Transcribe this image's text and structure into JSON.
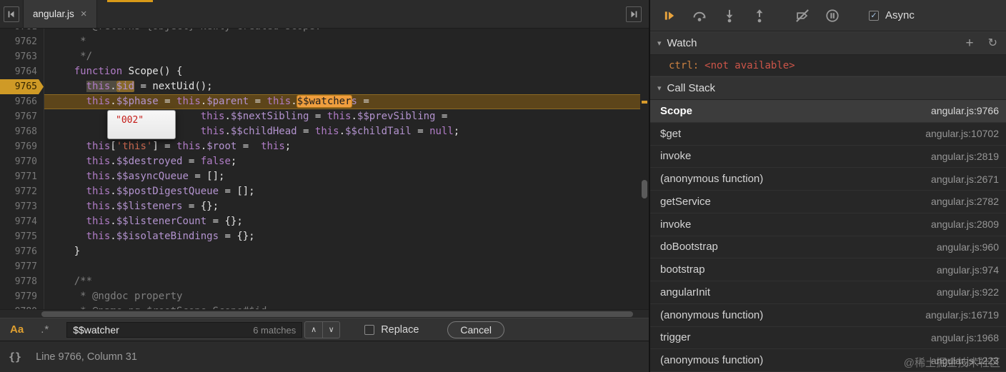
{
  "tab": {
    "title": "angular.js",
    "close": "×"
  },
  "icons": {
    "triangle_down": "▾",
    "plus": "+",
    "refresh": "↻",
    "chevron_up": "∧",
    "chevron_down": "∨",
    "check": "✓",
    "braces": "{}"
  },
  "editor": {
    "tooltip_value": "\"002\"",
    "lines": [
      {
        "n": 9761,
        "tokens": [
          {
            "t": "     * @returns {Object} Newly created scope.",
            "c": "c"
          }
        ]
      },
      {
        "n": 9762,
        "tokens": [
          {
            "t": "     *",
            "c": "c"
          }
        ]
      },
      {
        "n": 9763,
        "tokens": [
          {
            "t": "     */",
            "c": "c"
          }
        ]
      },
      {
        "n": 9764,
        "tokens": [
          {
            "t": "    ",
            "c": "d"
          },
          {
            "t": "function",
            "c": "k"
          },
          {
            "t": " Scope() {",
            "c": "d"
          }
        ]
      },
      {
        "n": 9765,
        "marker": true,
        "tokens": [
          {
            "t": "      ",
            "c": "d"
          },
          {
            "t": "this",
            "c": "k hovA"
          },
          {
            "t": ".",
            "c": "d hovA"
          },
          {
            "t": "$id",
            "c": "p hovB"
          },
          {
            "t": " = nextUid();",
            "c": "d"
          }
        ]
      },
      {
        "n": 9766,
        "exec": true,
        "tokens": [
          {
            "t": "      ",
            "c": "d"
          },
          {
            "t": "this",
            "c": "k"
          },
          {
            "t": ".",
            "c": "d"
          },
          {
            "t": "$$phase",
            "c": "p"
          },
          {
            "t": " = ",
            "c": "d"
          },
          {
            "t": "this",
            "c": "k"
          },
          {
            "t": ".",
            "c": "d"
          },
          {
            "t": "$parent",
            "c": "p"
          },
          {
            "t": " = ",
            "c": "d"
          },
          {
            "t": "this",
            "c": "k"
          },
          {
            "t": ".",
            "c": "d"
          },
          {
            "t": "$$watcher",
            "c": "p m"
          },
          {
            "t": "s",
            "c": "p"
          },
          {
            "t": " =",
            "c": "d"
          }
        ]
      },
      {
        "n": 9767,
        "tokens": [
          {
            "t": "                         ",
            "c": "d"
          },
          {
            "t": "this",
            "c": "k"
          },
          {
            "t": ".",
            "c": "d"
          },
          {
            "t": "$$nextSibling",
            "c": "p"
          },
          {
            "t": " = ",
            "c": "d"
          },
          {
            "t": "this",
            "c": "k"
          },
          {
            "t": ".",
            "c": "d"
          },
          {
            "t": "$$prevSibling",
            "c": "p"
          },
          {
            "t": " =",
            "c": "d"
          }
        ]
      },
      {
        "n": 9768,
        "tokens": [
          {
            "t": "                         ",
            "c": "d"
          },
          {
            "t": "this",
            "c": "k"
          },
          {
            "t": ".",
            "c": "d"
          },
          {
            "t": "$$childHead",
            "c": "p"
          },
          {
            "t": " = ",
            "c": "d"
          },
          {
            "t": "this",
            "c": "k"
          },
          {
            "t": ".",
            "c": "d"
          },
          {
            "t": "$$childTail",
            "c": "p"
          },
          {
            "t": " = ",
            "c": "d"
          },
          {
            "t": "null",
            "c": "k"
          },
          {
            "t": ";",
            "c": "d"
          }
        ]
      },
      {
        "n": 9769,
        "tokens": [
          {
            "t": "      ",
            "c": "d"
          },
          {
            "t": "this",
            "c": "k"
          },
          {
            "t": "[",
            "c": "d"
          },
          {
            "t": "'this'",
            "c": "s"
          },
          {
            "t": "] = ",
            "c": "d"
          },
          {
            "t": "this",
            "c": "k"
          },
          {
            "t": ".",
            "c": "d"
          },
          {
            "t": "$root",
            "c": "p"
          },
          {
            "t": " =  ",
            "c": "d"
          },
          {
            "t": "this",
            "c": "k"
          },
          {
            "t": ";",
            "c": "d"
          }
        ]
      },
      {
        "n": 9770,
        "tokens": [
          {
            "t": "      ",
            "c": "d"
          },
          {
            "t": "this",
            "c": "k"
          },
          {
            "t": ".",
            "c": "d"
          },
          {
            "t": "$$destroyed",
            "c": "p"
          },
          {
            "t": " = ",
            "c": "d"
          },
          {
            "t": "false",
            "c": "k"
          },
          {
            "t": ";",
            "c": "d"
          }
        ]
      },
      {
        "n": 9771,
        "tokens": [
          {
            "t": "      ",
            "c": "d"
          },
          {
            "t": "this",
            "c": "k"
          },
          {
            "t": ".",
            "c": "d"
          },
          {
            "t": "$$asyncQueue",
            "c": "p"
          },
          {
            "t": " = [];",
            "c": "d"
          }
        ]
      },
      {
        "n": 9772,
        "tokens": [
          {
            "t": "      ",
            "c": "d"
          },
          {
            "t": "this",
            "c": "k"
          },
          {
            "t": ".",
            "c": "d"
          },
          {
            "t": "$$postDigestQueue",
            "c": "p"
          },
          {
            "t": " = [];",
            "c": "d"
          }
        ]
      },
      {
        "n": 9773,
        "tokens": [
          {
            "t": "      ",
            "c": "d"
          },
          {
            "t": "this",
            "c": "k"
          },
          {
            "t": ".",
            "c": "d"
          },
          {
            "t": "$$listeners",
            "c": "p"
          },
          {
            "t": " = {};",
            "c": "d"
          }
        ]
      },
      {
        "n": 9774,
        "tokens": [
          {
            "t": "      ",
            "c": "d"
          },
          {
            "t": "this",
            "c": "k"
          },
          {
            "t": ".",
            "c": "d"
          },
          {
            "t": "$$listenerCount",
            "c": "p"
          },
          {
            "t": " = {};",
            "c": "d"
          }
        ]
      },
      {
        "n": 9775,
        "tokens": [
          {
            "t": "      ",
            "c": "d"
          },
          {
            "t": "this",
            "c": "k"
          },
          {
            "t": ".",
            "c": "d"
          },
          {
            "t": "$$isolateBindings",
            "c": "p"
          },
          {
            "t": " = {};",
            "c": "d"
          }
        ]
      },
      {
        "n": 9776,
        "tokens": [
          {
            "t": "    }",
            "c": "d"
          }
        ]
      },
      {
        "n": 9777,
        "tokens": [
          {
            "t": " ",
            "c": "d"
          }
        ]
      },
      {
        "n": 9778,
        "tokens": [
          {
            "t": "    /**",
            "c": "c"
          }
        ]
      },
      {
        "n": 9779,
        "tokens": [
          {
            "t": "     * @ngdoc property",
            "c": "c"
          }
        ]
      },
      {
        "n": 9780,
        "tokens": [
          {
            "t": "     * @name ng.$rootScope.Scope#$id",
            "c": "c"
          }
        ]
      }
    ]
  },
  "findbar": {
    "case_toggle": "Aa",
    "regex_toggle": ".*",
    "query": "$$watcher",
    "matches_label": "6 matches",
    "replace_label": "Replace",
    "cancel_label": "Cancel"
  },
  "statusbar": {
    "position_label": "Line 9766, Column 31"
  },
  "toolbar": {
    "async_label": "Async",
    "async_checked": true
  },
  "watch": {
    "title": "Watch",
    "items": [
      {
        "name": "ctrl:",
        "value": "<not available>"
      }
    ]
  },
  "call_stack": {
    "title": "Call Stack",
    "frames": [
      {
        "fn": "Scope",
        "loc": "angular.js:9766",
        "selected": true
      },
      {
        "fn": "$get",
        "loc": "angular.js:10702"
      },
      {
        "fn": "invoke",
        "loc": "angular.js:2819"
      },
      {
        "fn": "(anonymous function)",
        "loc": "angular.js:2671"
      },
      {
        "fn": "getService",
        "loc": "angular.js:2782"
      },
      {
        "fn": "invoke",
        "loc": "angular.js:2809"
      },
      {
        "fn": "doBootstrap",
        "loc": "angular.js:960"
      },
      {
        "fn": "bootstrap",
        "loc": "angular.js:974"
      },
      {
        "fn": "angularInit",
        "loc": "angular.js:922"
      },
      {
        "fn": "(anonymous function)",
        "loc": "angular.js:16719"
      },
      {
        "fn": "trigger",
        "loc": "angular.js:1968"
      },
      {
        "fn": "(anonymous function)",
        "loc": "angular.js:1223"
      }
    ]
  },
  "watermark": "@稀土掘金技术社区"
}
